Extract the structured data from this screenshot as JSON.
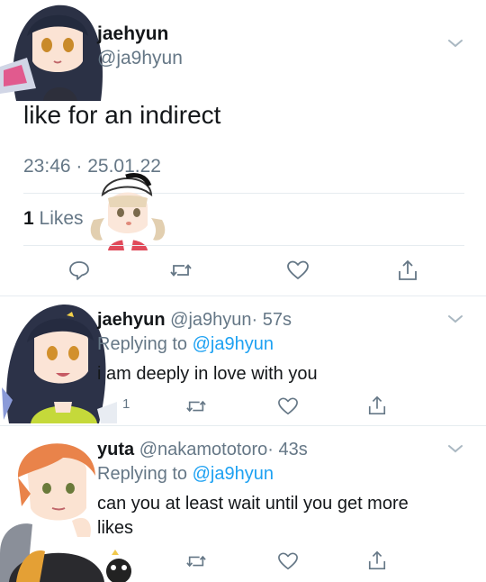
{
  "main_tweet": {
    "display_name": "jaehyun",
    "handle": "@ja9hyun",
    "text": "like for an indirect",
    "timestamp": "23:46 · 25.01.22",
    "likes_count": "1",
    "likes_label": "Likes"
  },
  "replies": [
    {
      "display_name": "jaehyun",
      "handle": "@ja9hyun",
      "time": "· 57s",
      "replying_prefix": "Replying to",
      "replying_to": "@ja9hyun",
      "text": "i am deeply in love with you",
      "reply_count": "1"
    },
    {
      "display_name": "yuta",
      "handle": "@nakamototoro",
      "time": "· 43s",
      "replying_prefix": "Replying to",
      "replying_to": "@ja9hyun",
      "text_line1": "can you at least wait until you get more",
      "text_line2": "likes"
    }
  ],
  "icons": [
    "reply-icon",
    "retweet-icon",
    "like-icon",
    "share-icon",
    "chevron-down-icon"
  ],
  "colors": {
    "text": "#14171a",
    "muted": "#657786",
    "link": "#1da1f2",
    "divider": "#e6ecf0"
  }
}
